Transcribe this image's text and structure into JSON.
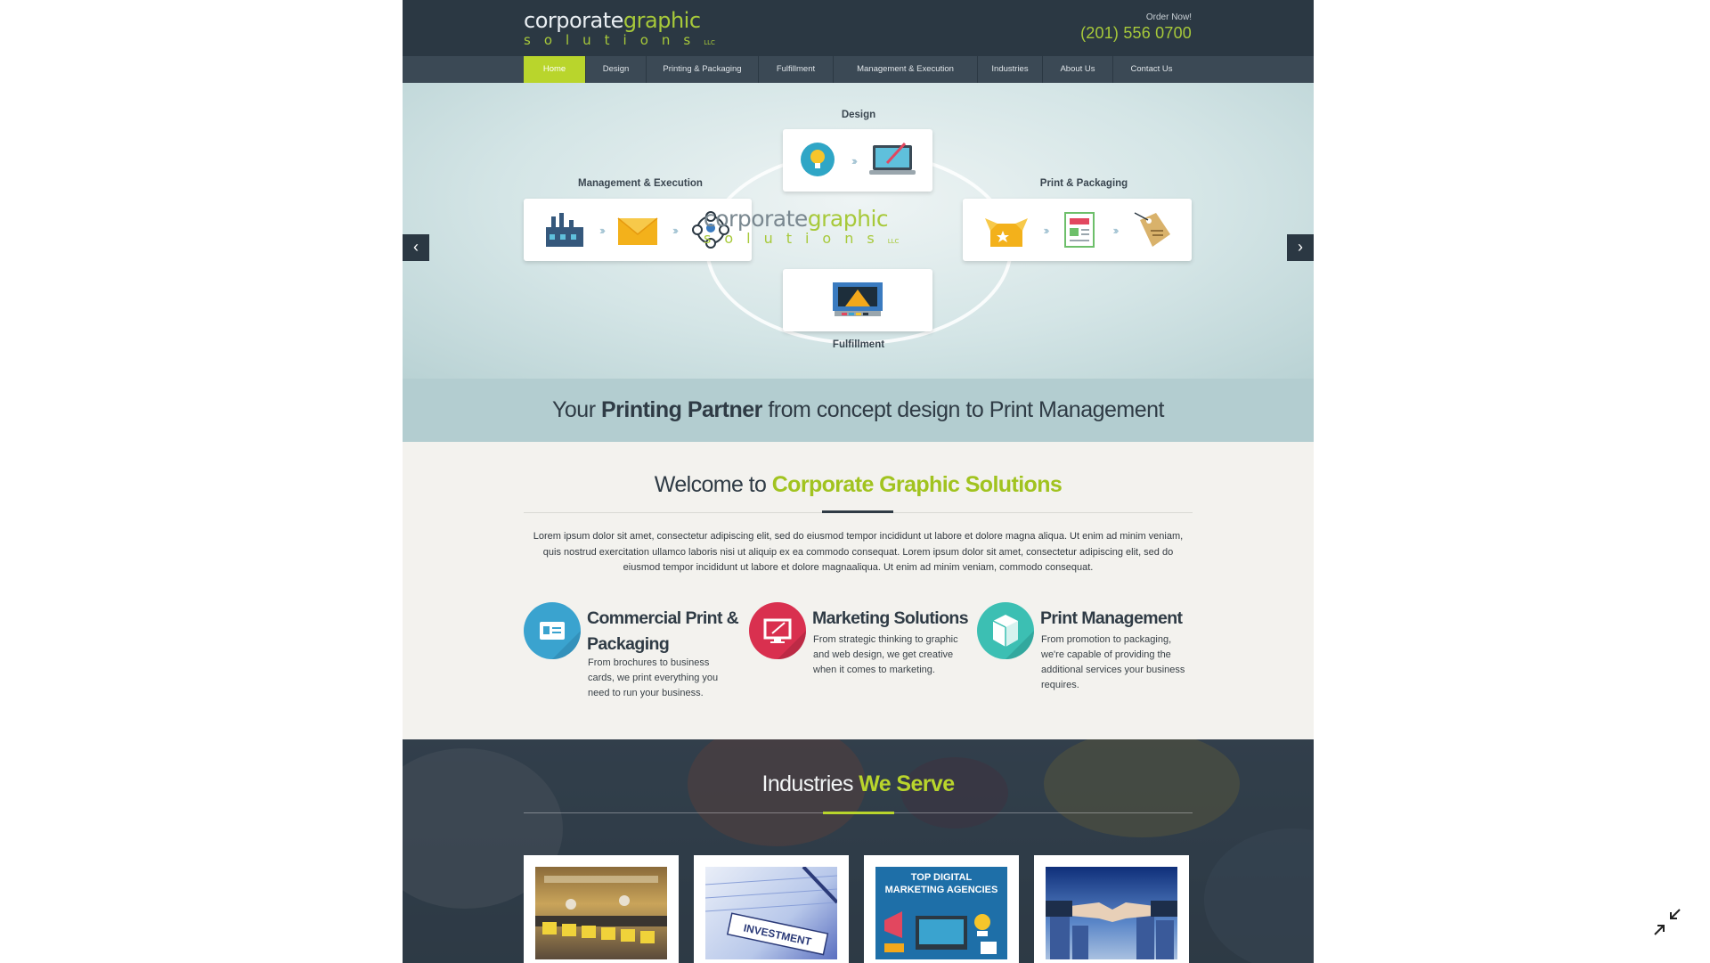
{
  "header": {
    "logo_top_a": "corporate",
    "logo_top_b": "graphic",
    "logo_bottom": "solutions",
    "logo_llc": "LLC",
    "order_label": "Order Now!",
    "order_phone": "(201) 556 0700"
  },
  "nav": {
    "items": [
      {
        "label": "Home"
      },
      {
        "label": "Design"
      },
      {
        "label": "Printing & Packaging"
      },
      {
        "label": "Fulfillment"
      },
      {
        "label": "Management & Execution"
      },
      {
        "label": "Industries"
      },
      {
        "label": "About Us"
      },
      {
        "label": "Contact Us"
      }
    ],
    "active": "Home"
  },
  "hero": {
    "design_label": "Design",
    "management_label": "Management & Execution",
    "print_label": "Print & Packaging",
    "fulfillment_label": "Fulfillment",
    "prev_icon": "chevron-left-icon",
    "next_icon": "chevron-right-icon"
  },
  "tagline": {
    "pre": "Your",
    "bold": "Printing Partner",
    "post": "from concept design to Print Management"
  },
  "welcome": {
    "title_pre": "Welcome to",
    "title_highlight": "Corporate Graphic Solutions",
    "body": "Lorem ipsum dolor sit amet, consectetur adipiscing elit, sed do eiusmod tempor incididunt ut labore et dolore magna aliqua. Ut enim ad minim veniam, quis nostrud exercitation ullamco laboris nisi ut aliquip ex ea commodo consequat. Lorem ipsum dolor sit amet, consectetur adipiscing elit, sed do eiusmod tempor incididunt ut labore et dolore magnaaliqua. Ut enim ad minim veniam,  commodo consequat."
  },
  "services": [
    {
      "title_line1": "Commercial Print &",
      "title_line2": "Packaging",
      "text": "From brochures to business cards, we print everything you need to run your business.",
      "color": "#3aa3cf"
    },
    {
      "title_line1": "Marketing Solutions",
      "title_line2": "",
      "text": "From strategic thinking to graphic and web design, we get creative when it comes to marketing.",
      "color": "#d9304f"
    },
    {
      "title_line1": "Print Management",
      "title_line2": "",
      "text": "From promotion to packaging, we're capable of providing the additional services your business requires.",
      "color": "#3cbfb3"
    }
  ],
  "industries": {
    "title_pre": "Industries",
    "title_highlight": "We Serve",
    "cards": [
      {
        "image": "factory-production-line"
      },
      {
        "image": "investment-document"
      },
      {
        "image": "marketing-agencies",
        "text_line1": "TOP DIGITAL",
        "text_line2": "MARKETING AGENCIES"
      },
      {
        "image": "business-handshake"
      }
    ]
  },
  "colors": {
    "header_bg": "#2b3843",
    "nav_bg": "#3b4955",
    "accent": "#b9d52c",
    "accent_text": "#a1c31f"
  }
}
